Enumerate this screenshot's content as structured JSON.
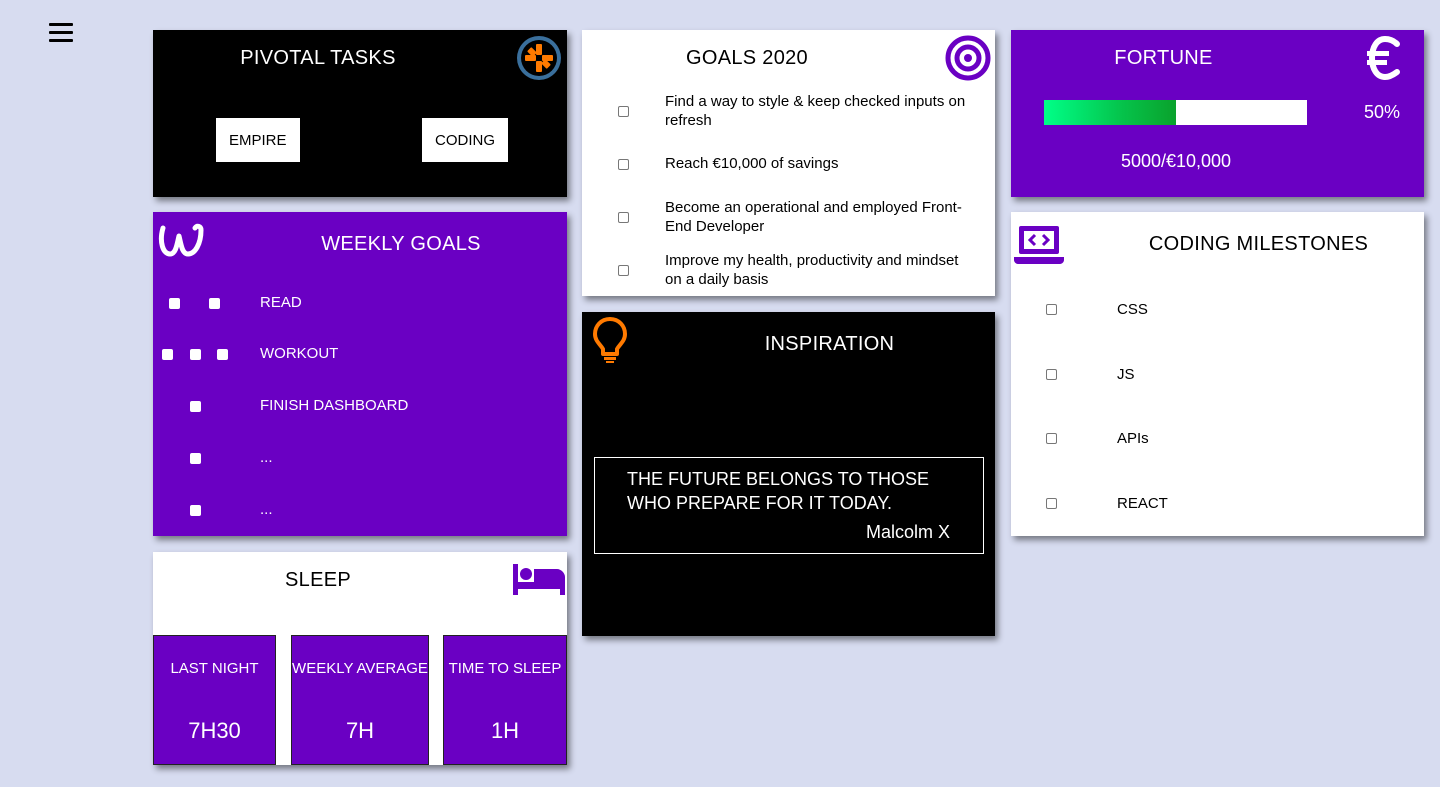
{
  "nav": {
    "menu_icon": "hamburger-menu-icon"
  },
  "pivotal": {
    "title": "PIVOTAL TASKS",
    "icon": "pivotal-tracker-logo-icon",
    "buttons": [
      "EMPIRE",
      "CODING"
    ]
  },
  "goals2020": {
    "title": "GOALS 2020",
    "icon": "target-icon",
    "items": [
      {
        "text": "Find a way to style & keep checked inputs on refresh",
        "checked": false
      },
      {
        "text": "Reach €10,000 of savings",
        "checked": false
      },
      {
        "text": "Become an operational and employed Front-End Developer",
        "checked": false
      },
      {
        "text": "Improve my health, productivity and mindset on a daily basis",
        "checked": false
      }
    ]
  },
  "fortune": {
    "title": "FORTUNE",
    "icon": "euro-icon",
    "progress_fraction": 0.5,
    "percent_label": "50%",
    "savings_label": "5000/€10,000"
  },
  "weekly": {
    "title": "WEEKLY GOALS",
    "icon": "weebly-logo-icon",
    "items": [
      {
        "label": "READ",
        "checkbox_count": 2
      },
      {
        "label": "WORKOUT",
        "checkbox_count": 3
      },
      {
        "label": "FINISH DASHBOARD",
        "checkbox_count": 1
      },
      {
        "label": "...",
        "checkbox_count": 1
      },
      {
        "label": "...",
        "checkbox_count": 1
      }
    ]
  },
  "inspiration": {
    "title": "INSPIRATION",
    "icon": "lightbulb-icon",
    "quote": "THE FUTURE BELONGS TO THOSE WHO PREPARE FOR IT TODAY.",
    "author": "Malcolm X"
  },
  "milestones": {
    "title": "CODING MILESTONES",
    "icon": "laptop-code-icon",
    "items": [
      "CSS",
      "JS",
      "APIs",
      "REACT"
    ]
  },
  "sleep": {
    "title": "SLEEP",
    "icon": "bed-icon",
    "stats": [
      {
        "label": "LAST NIGHT",
        "value": "7H30"
      },
      {
        "label": "WEEKLY AVERAGE",
        "value": "7H"
      },
      {
        "label": "TIME TO SLEEP",
        "value": "1H"
      }
    ]
  },
  "colors": {
    "background": "#d7dcf0",
    "purple": "#6a00c3",
    "accent_orange": "#ff7a00",
    "progress_green": "#05c24a"
  }
}
